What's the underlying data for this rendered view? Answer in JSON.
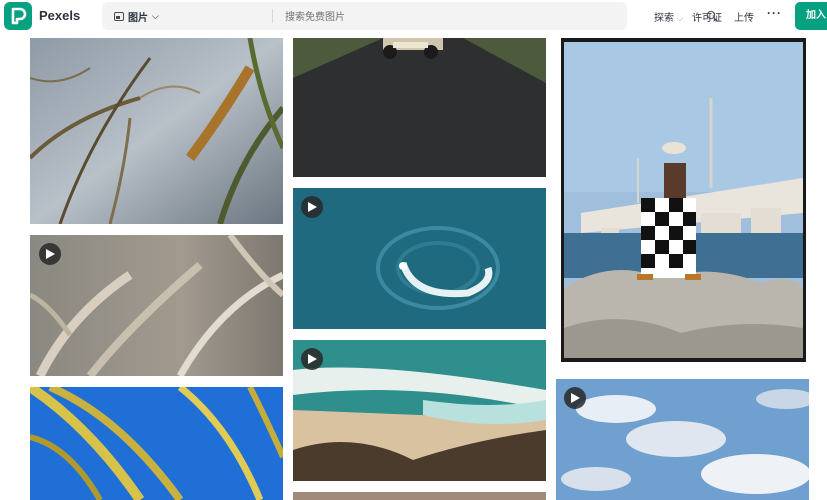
{
  "header": {
    "brand": "Pexels",
    "search_type": "图片",
    "search_placeholder": "搜索免费图片",
    "nav": {
      "explore": "探索",
      "license": "许可证",
      "upload": "上传",
      "more": "···"
    },
    "join": "加入"
  },
  "colors": {
    "brand": "#07a081",
    "text": "#2c343e"
  },
  "icons": {
    "logo": "pexels-logo-icon",
    "image_type": "image-icon",
    "chevron": "chevron-down-icon",
    "search": "search-icon",
    "play": "play-icon"
  },
  "grid": {
    "columns": [
      {
        "tiles": [
          {
            "subject": "dry reed grass",
            "video": false
          },
          {
            "subject": "wheat ears close-up",
            "video": true
          },
          {
            "subject": "palm fronds against blue sky",
            "video": false
          }
        ]
      },
      {
        "tiles": [
          {
            "subject": "motorcycle on road",
            "video": false
          },
          {
            "subject": "boat wake spiral in ocean",
            "video": true
          },
          {
            "subject": "aerial beach with rocks",
            "video": true
          },
          {
            "subject": "partial tile",
            "video": false
          }
        ]
      },
      {
        "tiles": [
          {
            "subject": "man in checkered pants on rocks by bridge",
            "video": false
          },
          {
            "subject": "clouds in sky",
            "video": true
          }
        ]
      }
    ]
  }
}
